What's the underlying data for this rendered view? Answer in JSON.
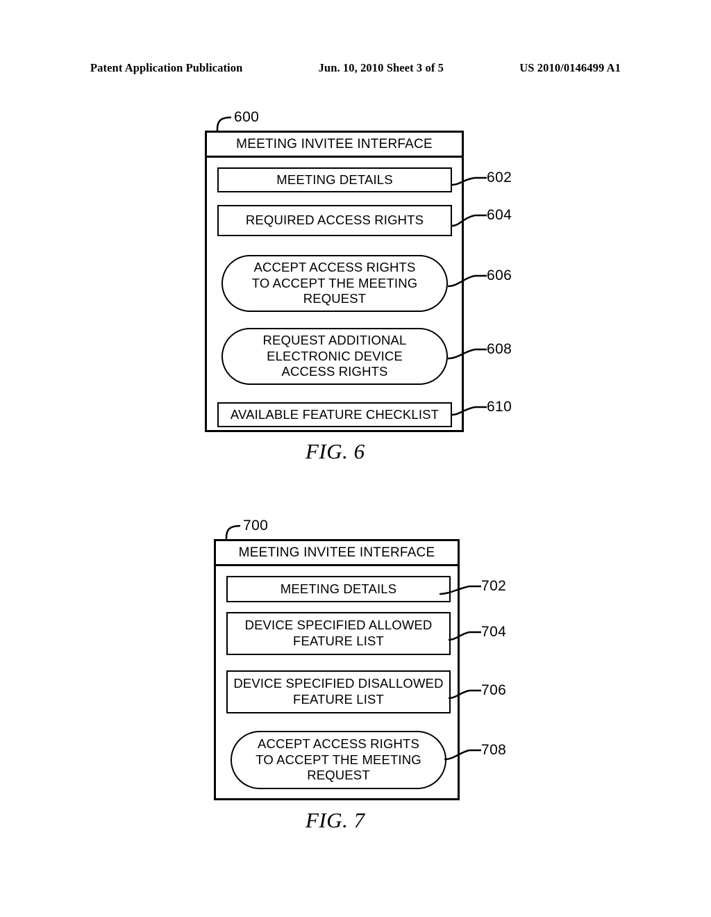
{
  "header": {
    "left": "Patent Application Publication",
    "middle": "Jun. 10, 2010  Sheet 3 of 5",
    "right": "US 2010/0146499 A1"
  },
  "figures": [
    {
      "caption": "FIG. 6",
      "ref": "600",
      "title": "MEETING INVITEE INTERFACE",
      "items": [
        {
          "label": "MEETING DETAILS",
          "ref": "602",
          "shape": "rect"
        },
        {
          "label": "REQUIRED ACCESS RIGHTS",
          "ref": "604",
          "shape": "rect"
        },
        {
          "label": "ACCEPT ACCESS RIGHTS\nTO ACCEPT THE MEETING\nREQUEST",
          "ref": "606",
          "shape": "stadium"
        },
        {
          "label": "REQUEST ADDITIONAL\nELECTRONIC DEVICE\nACCESS RIGHTS",
          "ref": "608",
          "shape": "stadium"
        },
        {
          "label": "AVAILABLE FEATURE CHECKLIST",
          "ref": "610",
          "shape": "rect"
        }
      ]
    },
    {
      "caption": "FIG. 7",
      "ref": "700",
      "title": "MEETING INVITEE INTERFACE",
      "items": [
        {
          "label": "MEETING DETAILS",
          "ref": "702",
          "shape": "rect"
        },
        {
          "label": "DEVICE SPECIFIED ALLOWED\nFEATURE LIST",
          "ref": "704",
          "shape": "rect"
        },
        {
          "label": "DEVICE SPECIFIED DISALLOWED\nFEATURE LIST",
          "ref": "706",
          "shape": "rect"
        },
        {
          "label": "ACCEPT ACCESS RIGHTS\nTO ACCEPT THE MEETING\nREQUEST",
          "ref": "708",
          "shape": "stadium"
        }
      ]
    }
  ]
}
